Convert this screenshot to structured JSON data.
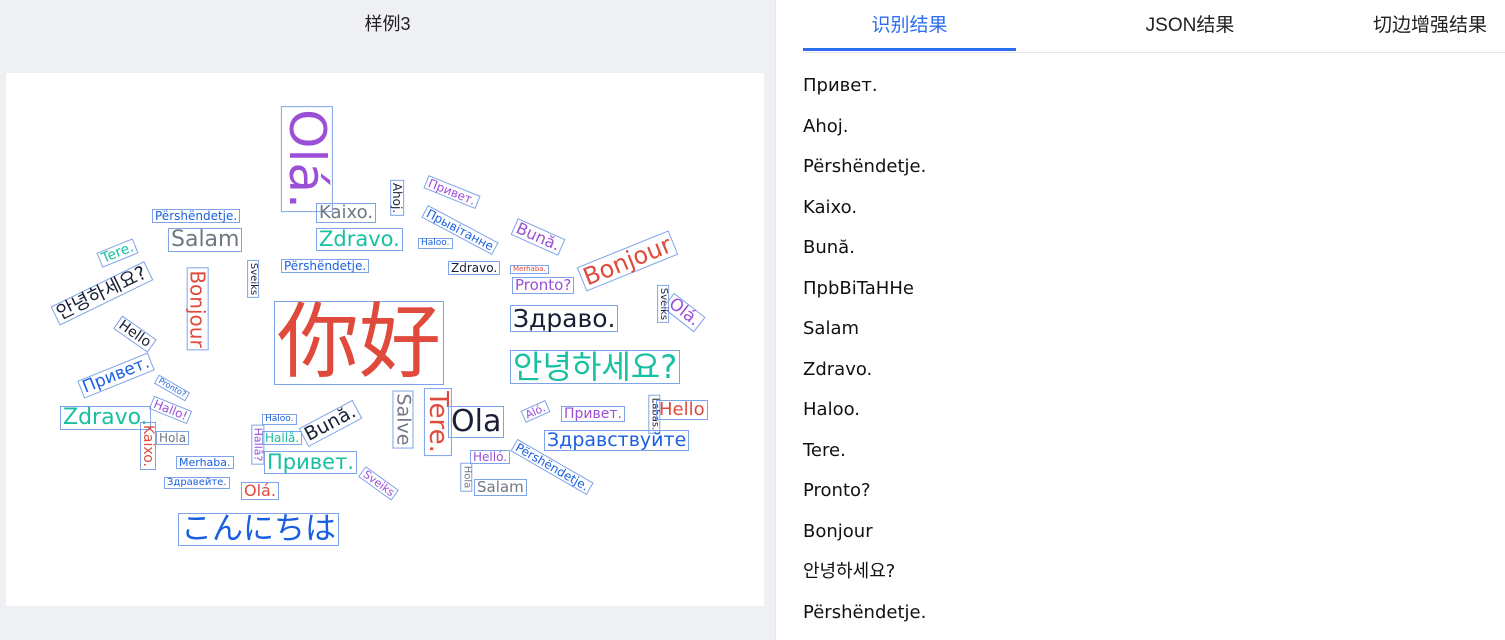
{
  "sample": {
    "title": "样例3"
  },
  "tabs": [
    {
      "label": "识别结果",
      "active": true
    },
    {
      "label": "JSON结果",
      "active": false
    },
    {
      "label": "切边增强结果",
      "active": false
    }
  ],
  "results": [
    "Привет.",
    "Ahoj.",
    "Përshëndetje.",
    "Kaixo.",
    "Bună.",
    "ПpbBiTaHHe",
    "Salam",
    "Zdravo.",
    "Haloo.",
    "Tere.",
    "Pronto?",
    "Bonjour",
    "안녕하세요?",
    "Përshëndetje."
  ],
  "colors": {
    "accent": "#2a6df0",
    "word_red": "#e04a3c",
    "word_purple": "#9b4fd6",
    "word_green": "#17c0a0",
    "word_blue": "#1a5fe0",
    "word_dark": "#1a1f36",
    "word_gray": "#707784"
  },
  "wordcloud": [
    {
      "text": "你好",
      "color": "#e04a3c"
    },
    {
      "text": "Olá.",
      "color": "#9b4fd6"
    },
    {
      "text": "Përshëndetje.",
      "color": "#1a5fe0"
    },
    {
      "text": "Kaixo.",
      "color": "#707784"
    },
    {
      "text": "Ahoj.",
      "color": "#1a1f36"
    },
    {
      "text": "Привет.",
      "color": "#9b4fd6"
    },
    {
      "text": "Прывітанне",
      "color": "#1a5fe0"
    },
    {
      "text": "Bună.",
      "color": "#9b4fd6"
    },
    {
      "text": "Salam",
      "color": "#707784"
    },
    {
      "text": "Zdravo.",
      "color": "#17c0a0"
    },
    {
      "text": "Haloo.",
      "color": "#1a5fe0"
    },
    {
      "text": "Tere.",
      "color": "#17c0a0"
    },
    {
      "text": "Përshëndetje.",
      "color": "#1a5fe0"
    },
    {
      "text": "Zdravo.",
      "color": "#1a1f36"
    },
    {
      "text": "Merhaba.",
      "color": "#e04a3c"
    },
    {
      "text": "Bonjour",
      "color": "#e04a3c"
    },
    {
      "text": "Pronto?",
      "color": "#9b4fd6"
    },
    {
      "text": "안녕하세요?",
      "color": "#1a1f36"
    },
    {
      "text": "Bonjour",
      "color": "#e04a3c"
    },
    {
      "text": "Sveiks",
      "color": "#1a1f36"
    },
    {
      "text": "Здраво.",
      "color": "#1a1f36"
    },
    {
      "text": "Sveiks",
      "color": "#1a1f36"
    },
    {
      "text": "Olá.",
      "color": "#9b4fd6"
    },
    {
      "text": "Hello",
      "color": "#1a1f36"
    },
    {
      "text": "안녕하세요?",
      "color": "#17c0a0"
    },
    {
      "text": "Привет.",
      "color": "#1a5fe0"
    },
    {
      "text": "Pronto?",
      "color": "#1a5fe0"
    },
    {
      "text": "Hallo!",
      "color": "#9b4fd6"
    },
    {
      "text": "Zdravo.",
      "color": "#17c0a0"
    },
    {
      "text": "Kaixo.",
      "color": "#e04a3c"
    },
    {
      "text": "Hola",
      "color": "#707784"
    },
    {
      "text": "Merhaba.",
      "color": "#1a5fe0"
    },
    {
      "text": "Здравейте.",
      "color": "#1a5fe0"
    },
    {
      "text": "Haloo.",
      "color": "#1a5fe0"
    },
    {
      "text": "Hallå.",
      "color": "#17c0a0"
    },
    {
      "text": "Hallå?",
      "color": "#9b4fd6"
    },
    {
      "text": "Bună.",
      "color": "#1a1f36"
    },
    {
      "text": "Привет.",
      "color": "#17c0a0"
    },
    {
      "text": "Olá.",
      "color": "#e04a3c"
    },
    {
      "text": "Salve",
      "color": "#707784"
    },
    {
      "text": "Tere.",
      "color": "#e04a3c"
    },
    {
      "text": "Ola",
      "color": "#1a1f36"
    },
    {
      "text": "Aló.",
      "color": "#9b4fd6"
    },
    {
      "text": "Привет.",
      "color": "#9b4fd6"
    },
    {
      "text": "Labas.",
      "color": "#1a1f36"
    },
    {
      "text": "Hello",
      "color": "#e04a3c"
    },
    {
      "text": "Здравствуйте",
      "color": "#1a5fe0"
    },
    {
      "text": "Helló.",
      "color": "#9b4fd6"
    },
    {
      "text": "Përshëndetje.",
      "color": "#1a5fe0"
    },
    {
      "text": "Sveiks",
      "color": "#9b4fd6"
    },
    {
      "text": "Hola",
      "color": "#707784"
    },
    {
      "text": "Salam",
      "color": "#707784"
    },
    {
      "text": "こんにちは",
      "color": "#1a5fe0"
    }
  ]
}
